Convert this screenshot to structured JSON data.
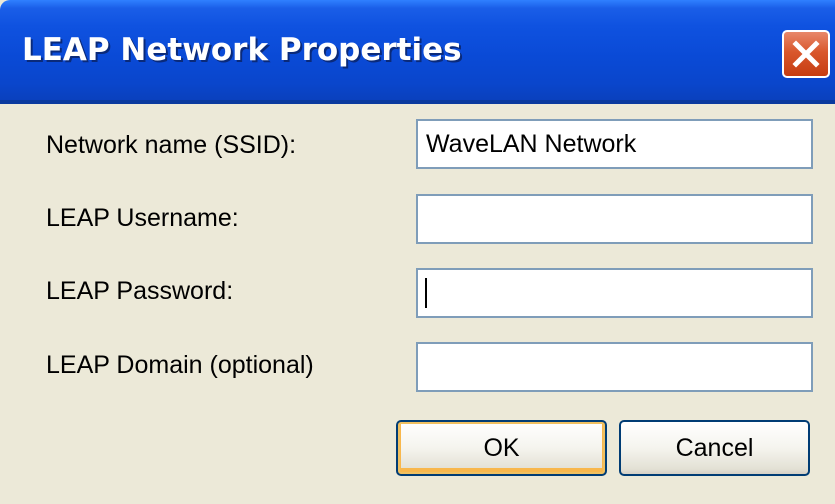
{
  "dialog": {
    "title": "LEAP Network Properties",
    "close_icon": "close-icon"
  },
  "fields": {
    "ssid": {
      "label": "Network name (SSID):",
      "value": "WaveLAN Network"
    },
    "username": {
      "label": "LEAP Username:",
      "value": ""
    },
    "password": {
      "label": "LEAP Password:",
      "value": ""
    },
    "domain": {
      "label": "LEAP Domain (optional)",
      "value": ""
    }
  },
  "buttons": {
    "ok_label": "OK",
    "cancel_label": "Cancel"
  },
  "colors": {
    "titlebar": "#0a4ad6",
    "close_button": "#d9572c",
    "dialog_bg": "#ece9d8",
    "field_border": "#7f9db9"
  }
}
